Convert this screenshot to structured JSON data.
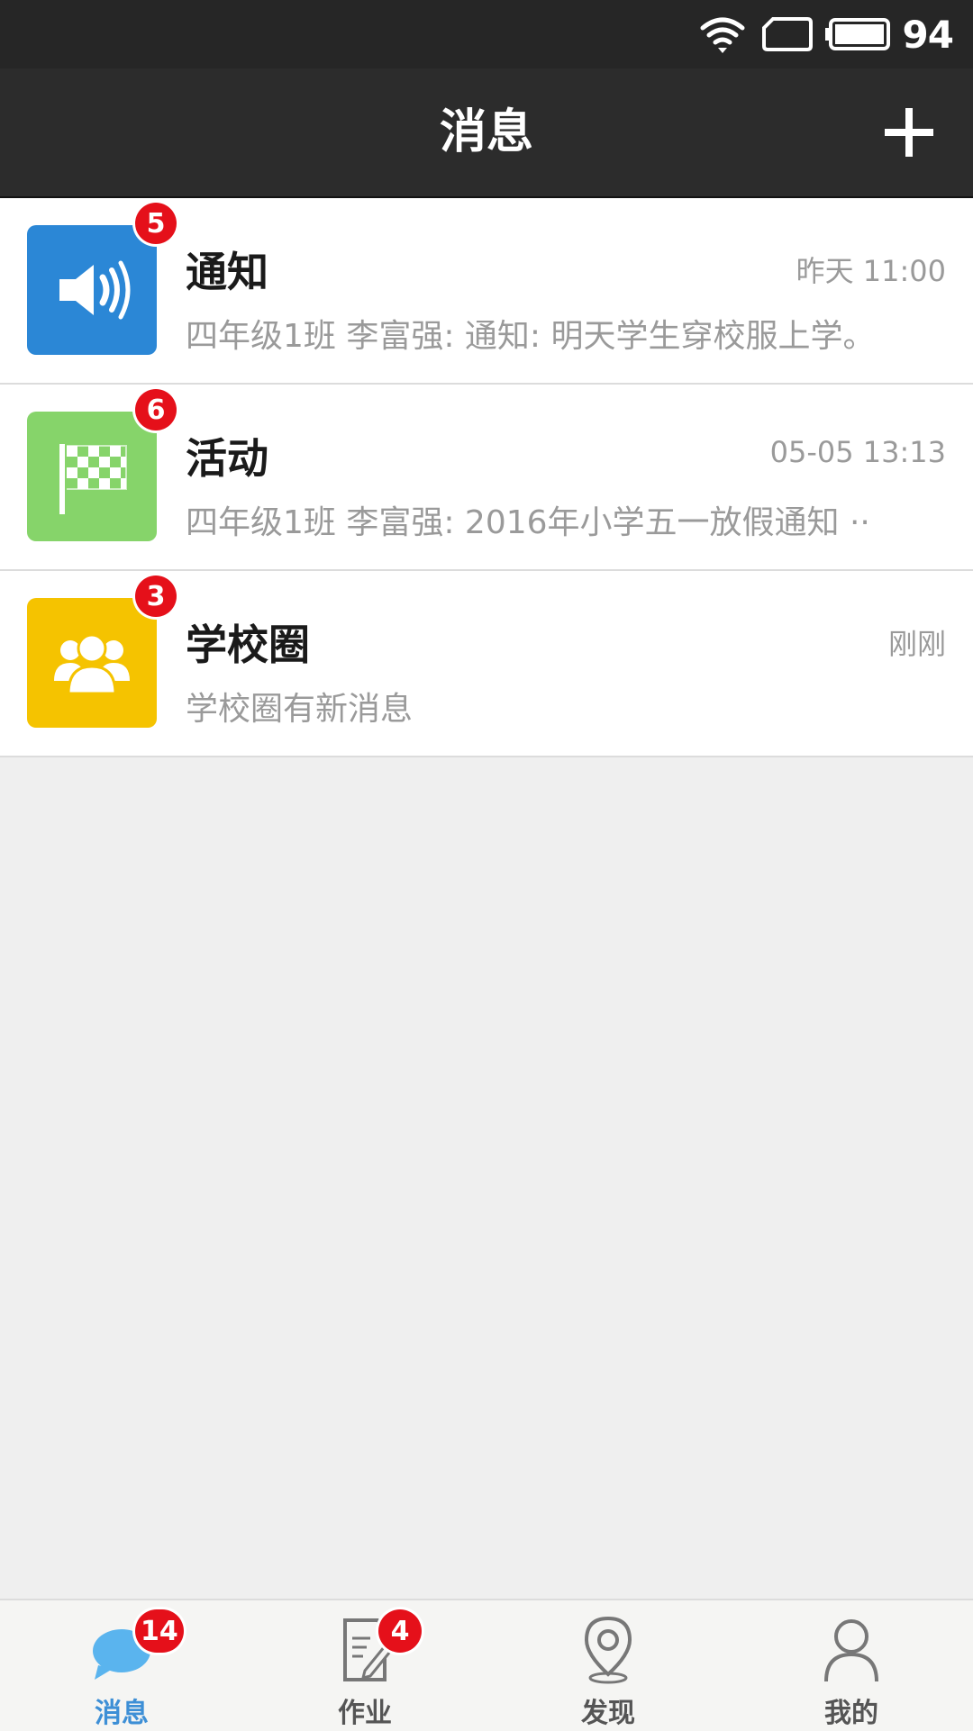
{
  "status_bar": {
    "battery": "94"
  },
  "header": {
    "title": "消息",
    "add_icon": "plus-icon"
  },
  "messages": [
    {
      "title": "通知",
      "time": "昨天 11:00",
      "preview": "四年级1班 李富强: 通知: 明天学生穿校服上学。",
      "badge": "5",
      "icon": "speaker-icon",
      "color": "#2b87d6"
    },
    {
      "title": "活动",
      "time": "05-05 13:13",
      "preview": "四年级1班 李富强: 2016年小学五一放假通知 ··",
      "badge": "6",
      "icon": "checkered-flag-icon",
      "color": "#86d46a"
    },
    {
      "title": "学校圈",
      "time": "刚刚",
      "preview": "学校圈有新消息",
      "badge": "3",
      "icon": "group-icon",
      "color": "#f5c300"
    }
  ],
  "tabbar": {
    "tabs": [
      {
        "label": "消息",
        "badge": "14",
        "icon": "chat-bubble-icon",
        "active": true
      },
      {
        "label": "作业",
        "badge": "4",
        "icon": "document-edit-icon",
        "active": false
      },
      {
        "label": "发现",
        "badge": "",
        "icon": "location-pin-icon",
        "active": false
      },
      {
        "label": "我的",
        "badge": "",
        "icon": "person-icon",
        "active": false
      }
    ]
  },
  "colors": {
    "accent": "#3d8fd6",
    "badge": "#e5101a",
    "header_bg": "#2c2c2c"
  }
}
